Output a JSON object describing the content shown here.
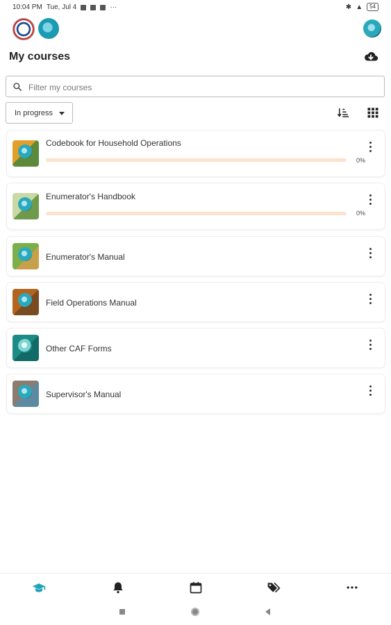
{
  "status_bar": {
    "time": "10:04 PM",
    "date": "Tue, Jul 4",
    "more": "···",
    "battery": "54"
  },
  "header": {
    "title": "My courses"
  },
  "search": {
    "placeholder": "Filter my courses",
    "value": ""
  },
  "filter": {
    "selected": "In progress"
  },
  "courses": [
    {
      "name": "Codebook for Household Operations",
      "progress": 0,
      "progress_label": "0%",
      "thumb_colors": [
        "#e0a02a",
        "#5c8a3a"
      ]
    },
    {
      "name": "Enumerator's Handbook",
      "progress": 0,
      "progress_label": "0%",
      "thumb_colors": [
        "#c9d9a5",
        "#6f9a4b"
      ]
    },
    {
      "name": "Enumerator's Manual",
      "progress": null,
      "progress_label": "",
      "thumb_colors": [
        "#7cae4a",
        "#c8a04a"
      ]
    },
    {
      "name": "Field Operations Manual",
      "progress": null,
      "progress_label": "",
      "thumb_colors": [
        "#b4641e",
        "#7a4a20"
      ]
    },
    {
      "name": "Other CAF Forms",
      "progress": null,
      "progress_label": "",
      "thumb_colors": [
        "#1c8a86",
        "#126a66"
      ]
    },
    {
      "name": "Supervisor's Manual",
      "progress": null,
      "progress_label": "",
      "thumb_colors": [
        "#8a7c70",
        "#5d8aa0"
      ]
    }
  ],
  "bottom_nav": [
    {
      "icon": "graduation-cap-icon",
      "active": true
    },
    {
      "icon": "bell-icon",
      "active": false
    },
    {
      "icon": "calendar-icon",
      "active": false
    },
    {
      "icon": "tags-icon",
      "active": false
    },
    {
      "icon": "more-icon",
      "active": false
    }
  ],
  "colors": {
    "accent": "#1fa3b8",
    "progress_track": "#fde2cf",
    "progress_fill": "#f47c20"
  }
}
